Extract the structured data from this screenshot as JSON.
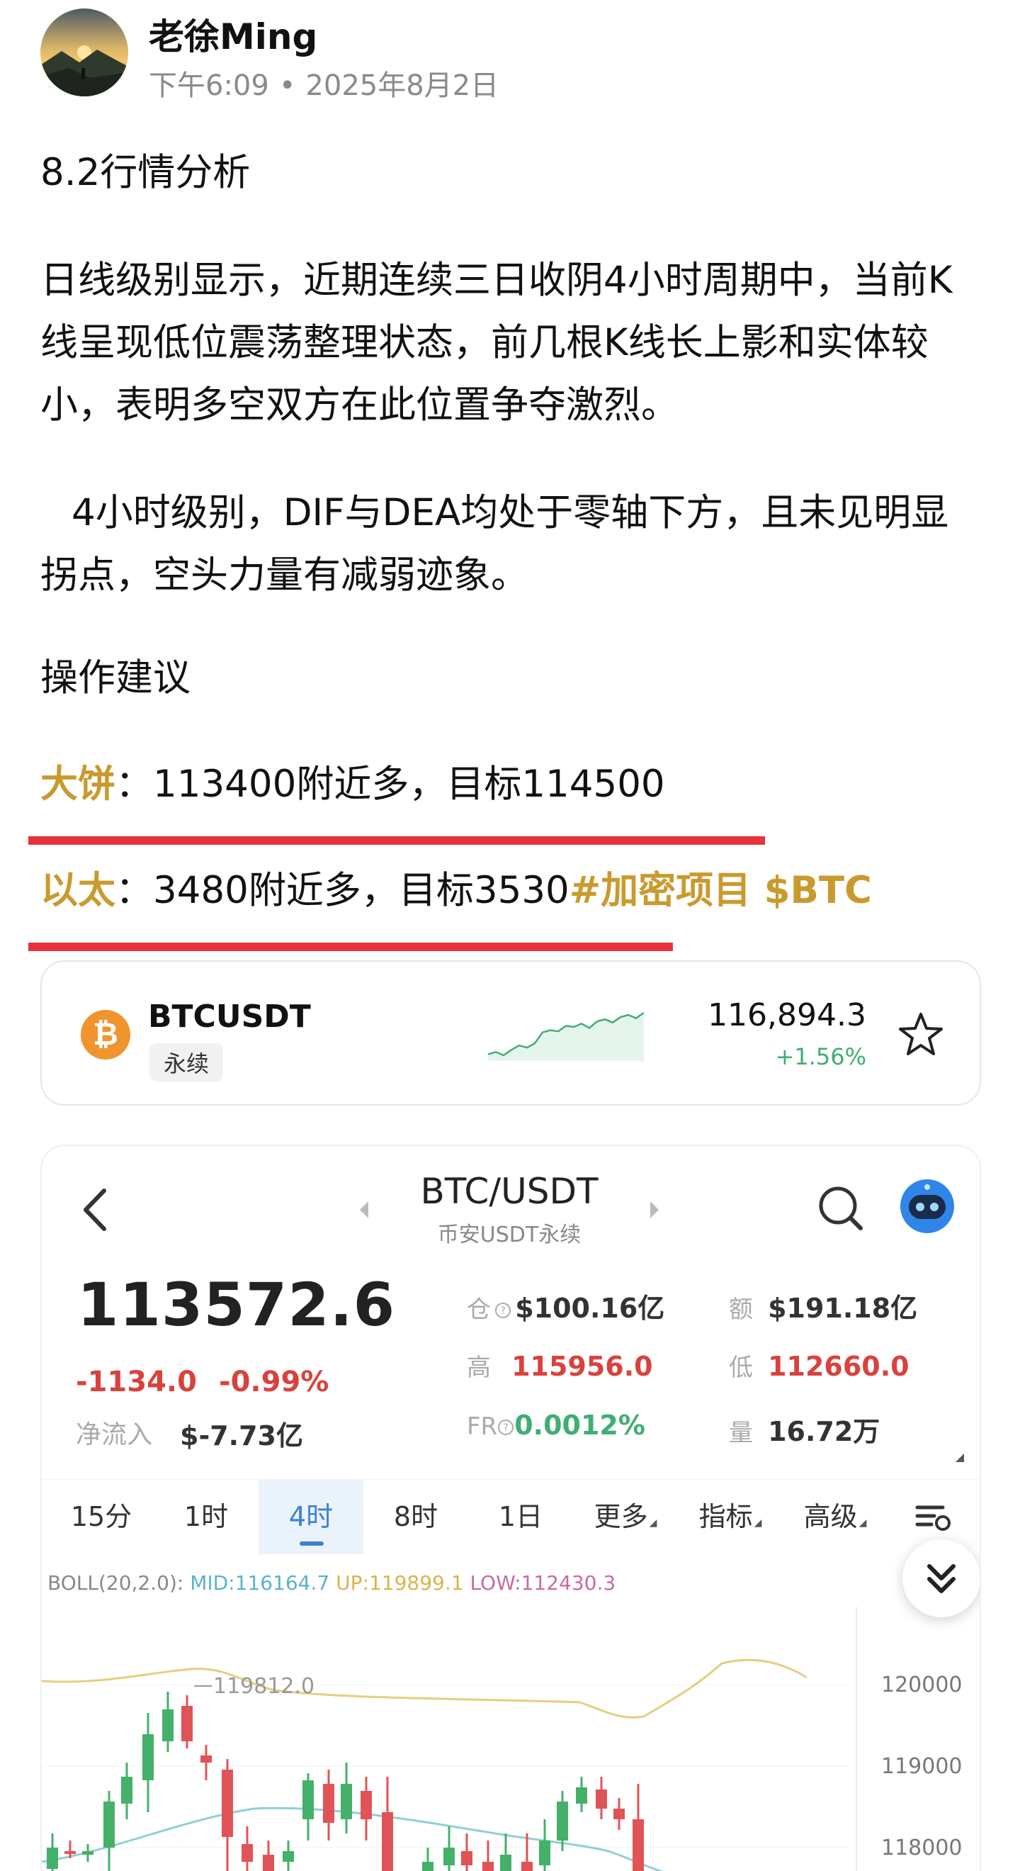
{
  "header": {
    "author": "老徐Ming",
    "time": "下午6:09",
    "separator": "•",
    "date": "2025年8月2日"
  },
  "post": {
    "title": "8.2行情分析",
    "paragraph1": "日线级别显示，近期连续三日收阴4小时周期中，当前K线呈现低位震荡整理状态，前几根K线长上影和实体较小，表明多空双方在此位置争夺激烈。",
    "paragraph2": "4小时级别，DIF与DEA均处于零轴下方，且未见明显拐点，空头力量有减弱迹象。",
    "advice_heading": "操作建议",
    "btc_label": "大饼",
    "btc_text": "：113400附近多，目标114500",
    "eth_label": "以太",
    "eth_text": "：3480附近多，目标3530",
    "hashtags": "#加密项目 $BTC"
  },
  "mini_card": {
    "coin_glyph": "₿",
    "symbol": "BTCUSDT",
    "tag": "永续",
    "price": "116,894.3",
    "change": "+1.56%",
    "sparkline": [
      10,
      12,
      9,
      14,
      18,
      16,
      20,
      30,
      32,
      31,
      36,
      35,
      38,
      34,
      40,
      42,
      39,
      44,
      46,
      43,
      48
    ]
  },
  "panel": {
    "pair": "BTC/USDT",
    "subtitle": "币安USDT永续",
    "last_price": "113572.6",
    "change_abs": "-1134.0",
    "change_pct": "-0.99%",
    "net_inflow_label": "净流入",
    "net_inflow_value": "$-7.73亿",
    "stats": {
      "oi_label": "仓",
      "oi_value": "$100.16亿",
      "turnover_label": "额",
      "turnover_value": "$191.18亿",
      "high_label": "高",
      "high_value": "115956.0",
      "low_label": "低",
      "low_value": "112660.0",
      "fr_label": "FR",
      "fr_value": "0.0012%",
      "volume_label": "量",
      "volume_value": "16.72万"
    },
    "tabs": [
      "15分",
      "1时",
      "4时",
      "8时",
      "1日",
      "更多",
      "指标",
      "高级"
    ],
    "active_tab": "4时",
    "boll": {
      "prefix": "BOLL(20,2.0):",
      "mid": "MID:116164.7",
      "up": "UP:119899.1",
      "low": "LOW:112430.3"
    },
    "chart_high_marker": "119812.0",
    "y_axis_labels": [
      "120000",
      "119000",
      "118000"
    ]
  },
  "colors": {
    "accent_gold": "#c99a2e",
    "underline_red": "#e8323b",
    "up_green": "#3fae74",
    "down_red": "#d9423c",
    "active_tab_blue": "#3b82d6"
  }
}
